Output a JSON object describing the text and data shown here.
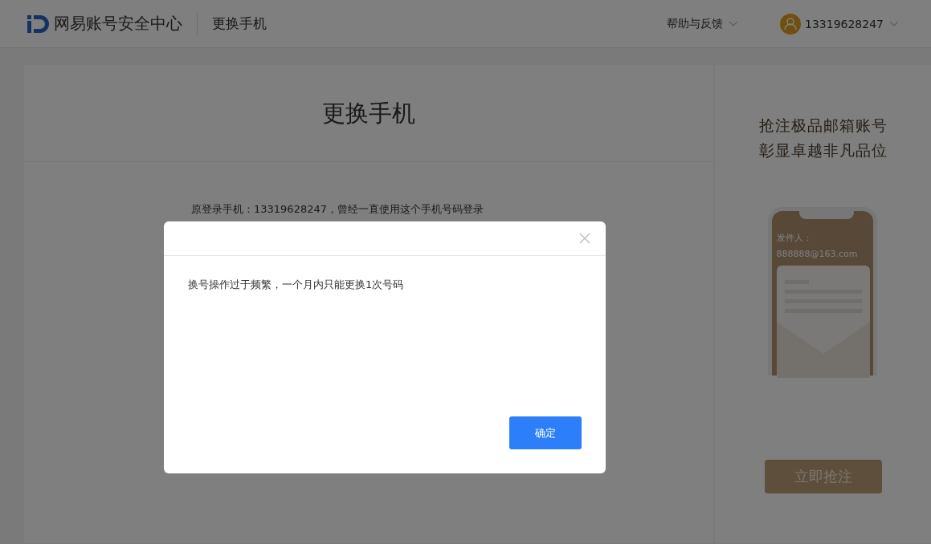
{
  "header": {
    "brand": "网易账号安全中心",
    "page_title": "更换手机",
    "help_menu": "帮助与反馈",
    "account": "13319628247"
  },
  "main": {
    "title": "更换手机",
    "notice": "原登录手机：13319628247，曾经一直使用这个手机号码登录"
  },
  "promo": {
    "headline": [
      "抢注极品邮箱账号",
      "彰显卓越非凡品位"
    ],
    "sender_label": "发件人：",
    "sender_email": "888888@163.com",
    "button": "立即抢注"
  },
  "dialog": {
    "message": "换号操作过于频繁，一个月内只能更换1次号码",
    "confirm": "确定"
  }
}
